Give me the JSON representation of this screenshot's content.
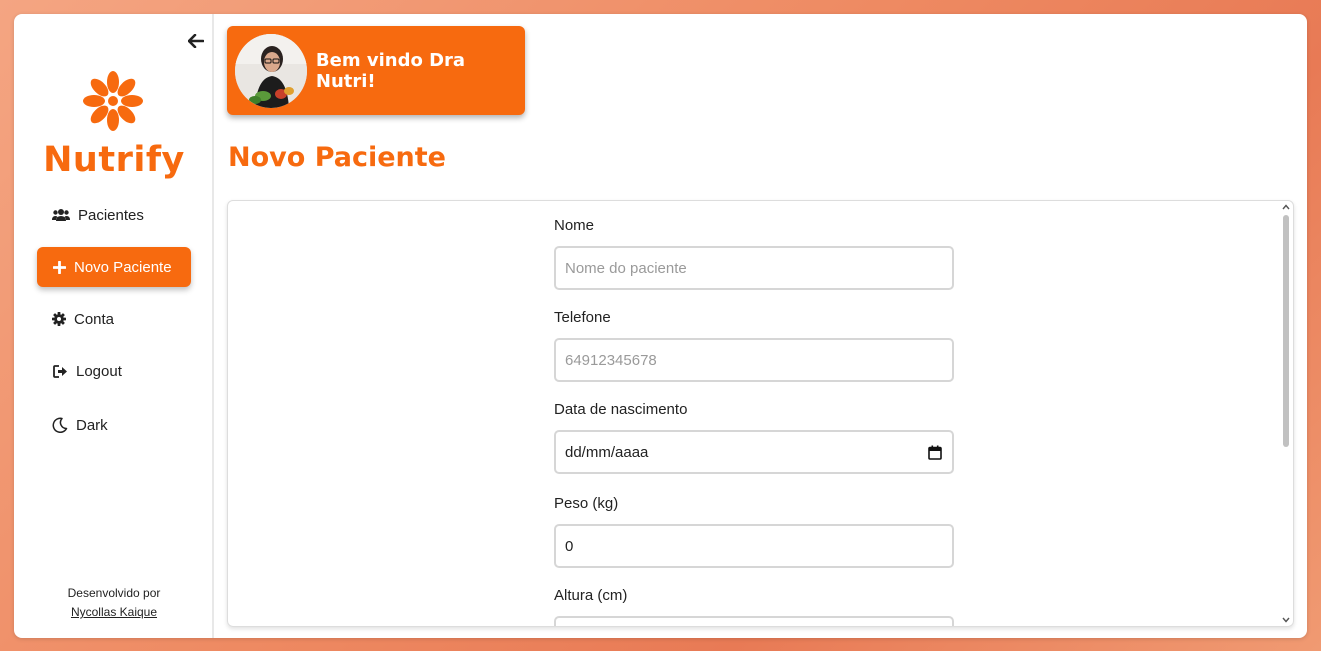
{
  "sidebar": {
    "logo_text": "Nutrify",
    "items": [
      {
        "label": "Pacientes",
        "icon": "users-icon"
      },
      {
        "label": "Novo Paciente",
        "icon": "plus-icon"
      },
      {
        "label": "Conta",
        "icon": "gear-icon"
      },
      {
        "label": "Logout",
        "icon": "sign-out-icon"
      },
      {
        "label": "Dark",
        "icon": "moon-icon"
      }
    ],
    "credit_text": "Desenvolvido por",
    "credit_link": "Nycollas Kaique"
  },
  "header": {
    "welcome_text": "Bem vindo Dra Nutri!"
  },
  "main": {
    "title": "Novo Paciente",
    "fields": [
      {
        "label": "Nome",
        "placeholder": "Nome do paciente",
        "value": ""
      },
      {
        "label": "Telefone",
        "placeholder": "64912345678",
        "value": ""
      },
      {
        "label": "Data de nascimento",
        "placeholder": "",
        "value": "dd/mm/aaaa"
      },
      {
        "label": "Peso (kg)",
        "placeholder": "",
        "value": "0"
      },
      {
        "label": "Altura (cm)",
        "placeholder": "",
        "value": ""
      }
    ]
  },
  "colors": {
    "accent": "#f76a0f",
    "background_gradient": [
      "#f4a582",
      "#e87a55"
    ]
  }
}
